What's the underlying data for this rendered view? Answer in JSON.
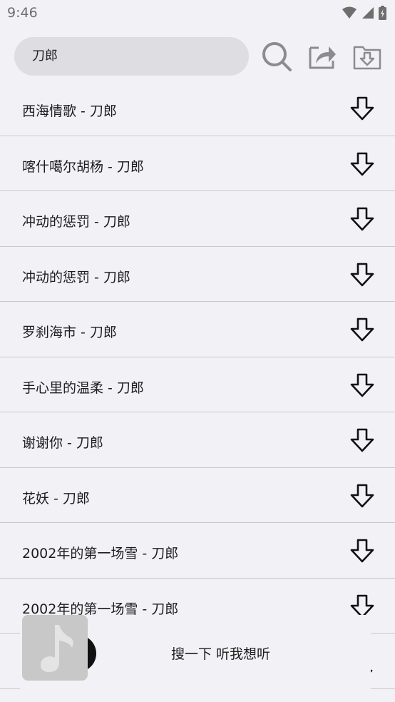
{
  "status": {
    "time": "9:46"
  },
  "search": {
    "query": "刀郎"
  },
  "icons": {
    "search": "search-icon",
    "share": "share-icon",
    "download_folder": "download-folder-icon",
    "download": "download-arrow-icon",
    "music_note": "music-note-icon"
  },
  "songs": [
    {
      "title": "西海情歌 - 刀郎"
    },
    {
      "title": "喀什噶尔胡杨 - 刀郎"
    },
    {
      "title": "冲动的惩罚 - 刀郎"
    },
    {
      "title": "冲动的惩罚 - 刀郎"
    },
    {
      "title": "罗刹海市 - 刀郎"
    },
    {
      "title": "手心里的温柔 - 刀郎"
    },
    {
      "title": "谢谢你 - 刀郎"
    },
    {
      "title": "花妖 - 刀郎"
    },
    {
      "title": "2002年的第一场雪 - 刀郎"
    },
    {
      "title": "2002年的第一场雪 - 刀郎"
    },
    {
      "title": ""
    }
  ],
  "player": {
    "label": "搜一下 听我想听"
  }
}
